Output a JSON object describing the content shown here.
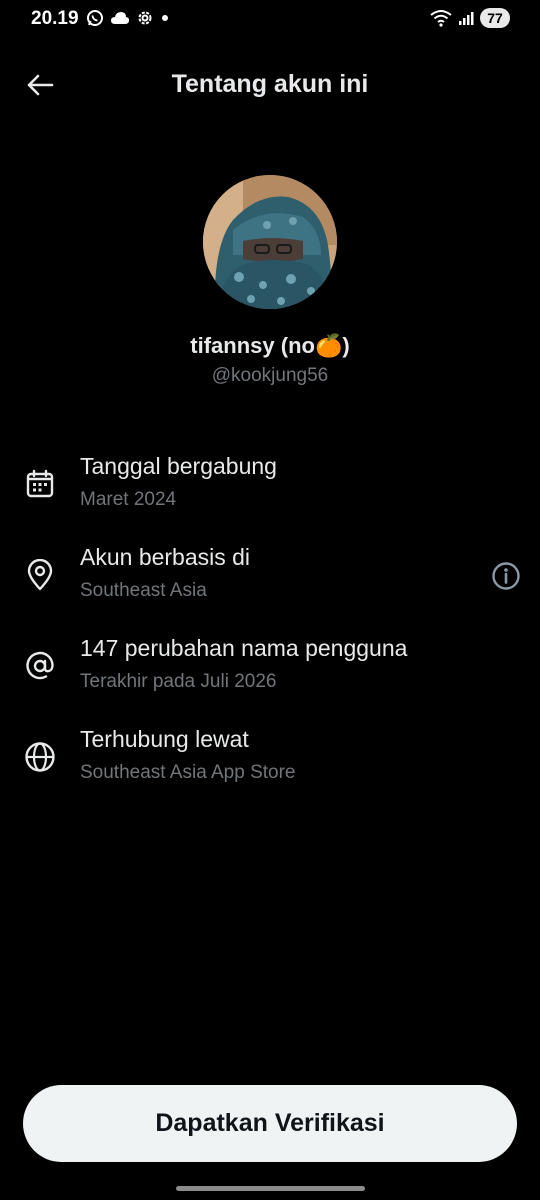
{
  "status_bar": {
    "time": "20.19",
    "battery": "77",
    "left_icons": [
      "whatsapp-icon",
      "cloud-icon",
      "settings-icon",
      "dot-icon"
    ],
    "right_icons": [
      "wifi-icon",
      "signal-icon",
      "battery-icon"
    ]
  },
  "header": {
    "title": "Tentang akun ini"
  },
  "profile": {
    "display_name": "tifannsy (no🍊)",
    "handle": "@kookjung56"
  },
  "items": [
    {
      "icon": "calendar-icon",
      "title": "Tanggal bergabung",
      "subtitle": "Maret 2024"
    },
    {
      "icon": "location-pin-icon",
      "title": "Akun berbasis di",
      "subtitle": "Southeast Asia",
      "action_icon": "info-icon"
    },
    {
      "icon": "at-sign-icon",
      "title": "147 perubahan nama pengguna",
      "subtitle": "Terakhir pada Juli 2026"
    },
    {
      "icon": "globe-icon",
      "title": "Terhubung lewat",
      "subtitle": "Southeast Asia App Store"
    }
  ],
  "footer": {
    "verify_label": "Dapatkan Verifikasi"
  }
}
